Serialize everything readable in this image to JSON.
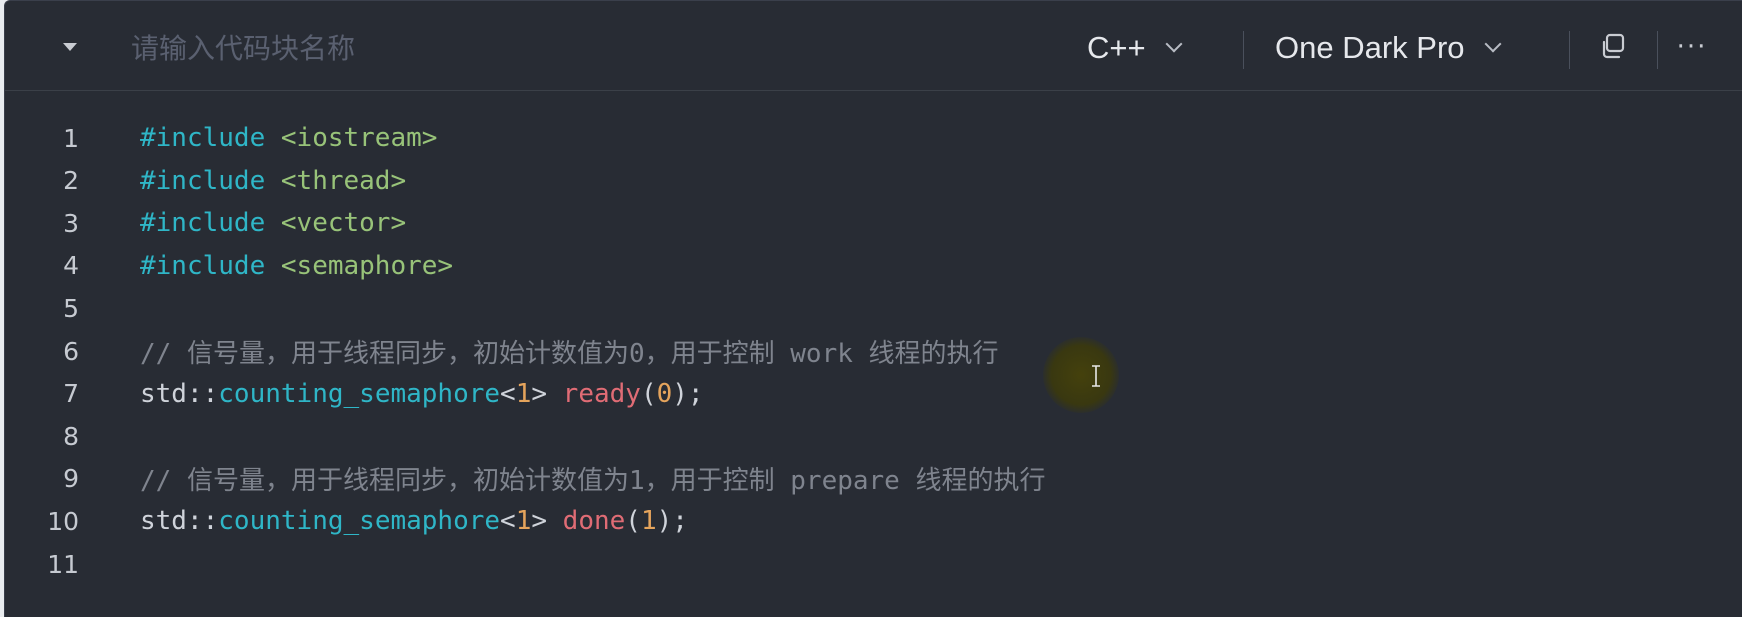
{
  "header": {
    "name_placeholder": "请输入代码块名称",
    "language": "C++",
    "theme": "One Dark Pro",
    "more_label": "···"
  },
  "code_lines": [
    {
      "n": "1",
      "tokens": [
        {
          "t": "#include ",
          "c": "kw"
        },
        {
          "t": "<iostream>",
          "c": "str"
        }
      ]
    },
    {
      "n": "2",
      "tokens": [
        {
          "t": "#include ",
          "c": "kw"
        },
        {
          "t": "<thread>",
          "c": "str"
        }
      ]
    },
    {
      "n": "3",
      "tokens": [
        {
          "t": "#include ",
          "c": "kw"
        },
        {
          "t": "<vector>",
          "c": "str"
        }
      ]
    },
    {
      "n": "4",
      "tokens": [
        {
          "t": "#include ",
          "c": "kw"
        },
        {
          "t": "<semaphore>",
          "c": "str"
        }
      ]
    },
    {
      "n": "5",
      "tokens": []
    },
    {
      "n": "6",
      "tokens": [
        {
          "t": "// 信号量，用于线程同步，初始计数值为0，用于控制 work 线程的执行",
          "c": "cm"
        }
      ]
    },
    {
      "n": "7",
      "tokens": [
        {
          "t": "std::",
          "c": "pl"
        },
        {
          "t": "counting_semaphore",
          "c": "ty"
        },
        {
          "t": "<",
          "c": "pl"
        },
        {
          "t": "1",
          "c": "num"
        },
        {
          "t": "> ",
          "c": "pl"
        },
        {
          "t": "ready",
          "c": "fn"
        },
        {
          "t": "(",
          "c": "pl"
        },
        {
          "t": "0",
          "c": "num"
        },
        {
          "t": ");",
          "c": "pl"
        }
      ]
    },
    {
      "n": "8",
      "tokens": []
    },
    {
      "n": "9",
      "tokens": [
        {
          "t": "// 信号量，用于线程同步，初始计数值为1，用于控制 prepare 线程的执行",
          "c": "cm"
        }
      ]
    },
    {
      "n": "10",
      "tokens": [
        {
          "t": "std::",
          "c": "pl"
        },
        {
          "t": "counting_semaphore",
          "c": "ty"
        },
        {
          "t": "<",
          "c": "pl"
        },
        {
          "t": "1",
          "c": "num"
        },
        {
          "t": "> ",
          "c": "pl"
        },
        {
          "t": "done",
          "c": "fn"
        },
        {
          "t": "(",
          "c": "pl"
        },
        {
          "t": "1",
          "c": "num"
        },
        {
          "t": ");",
          "c": "pl"
        }
      ]
    },
    {
      "n": "11",
      "tokens": []
    }
  ]
}
